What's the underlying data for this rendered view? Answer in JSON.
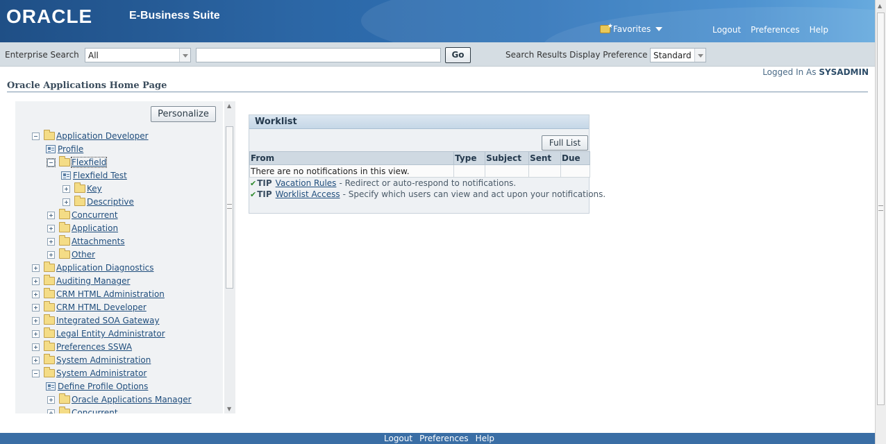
{
  "header": {
    "logo_text": "ORACLE",
    "suite_name": "E-Business Suite",
    "favorites_label": "Favorites",
    "links": [
      "Logout",
      "Preferences",
      "Help"
    ]
  },
  "search": {
    "label": "Enterprise Search",
    "scope_value": "All",
    "query_value": "",
    "go_label": "Go",
    "display_pref_label": "Search Results Display Preference",
    "display_pref_value": "Standard"
  },
  "session": {
    "logged_in_label": "Logged In As",
    "user": "SYSADMIN"
  },
  "page_title": "Oracle Applications Home Page",
  "navigator": {
    "personalize_label": "Personalize",
    "items": [
      {
        "label": "Application Developer",
        "type": "folder",
        "state": "expanded",
        "level": 0
      },
      {
        "label": "Profile",
        "type": "function",
        "level": 0
      },
      {
        "label": "Flexfield",
        "type": "folder",
        "state": "expanded",
        "level": 1,
        "selected": true
      },
      {
        "label": "Flexfield Test",
        "type": "function",
        "level": 1
      },
      {
        "label": "Key",
        "type": "folder",
        "state": "collapsed",
        "level": 2
      },
      {
        "label": "Descriptive",
        "type": "folder",
        "state": "collapsed",
        "level": 2
      },
      {
        "label": "Concurrent",
        "type": "folder",
        "state": "collapsed",
        "level": 1
      },
      {
        "label": "Application",
        "type": "folder",
        "state": "collapsed",
        "level": 1
      },
      {
        "label": "Attachments",
        "type": "folder",
        "state": "collapsed",
        "level": 1
      },
      {
        "label": "Other",
        "type": "folder",
        "state": "collapsed",
        "level": 1
      },
      {
        "label": "Application Diagnostics",
        "type": "folder",
        "state": "collapsed",
        "level": 0
      },
      {
        "label": "Auditing Manager",
        "type": "folder",
        "state": "collapsed",
        "level": 0
      },
      {
        "label": "CRM HTML Administration",
        "type": "folder",
        "state": "collapsed",
        "level": 0
      },
      {
        "label": "CRM HTML Developer",
        "type": "folder",
        "state": "collapsed",
        "level": 0
      },
      {
        "label": "Integrated SOA Gateway",
        "type": "folder",
        "state": "collapsed",
        "level": 0
      },
      {
        "label": "Legal Entity Administrator",
        "type": "folder",
        "state": "collapsed",
        "level": 0
      },
      {
        "label": "Preferences SSWA",
        "type": "folder",
        "state": "collapsed",
        "level": 0
      },
      {
        "label": "System Administration",
        "type": "folder",
        "state": "collapsed",
        "level": 0
      },
      {
        "label": "System Administrator",
        "type": "folder",
        "state": "expanded",
        "level": 0
      },
      {
        "label": "Define Profile Options",
        "type": "function",
        "level": 0
      },
      {
        "label": "Oracle Applications Manager",
        "type": "folder",
        "state": "collapsed",
        "level": 1
      },
      {
        "label": "Concurrent",
        "type": "folder",
        "state": "collapsed",
        "level": 1
      }
    ]
  },
  "worklist": {
    "title": "Worklist",
    "full_list_label": "Full List",
    "columns": [
      "From",
      "Type",
      "Subject",
      "Sent",
      "Due"
    ],
    "empty_message": "There are no notifications in this view.",
    "tips": [
      {
        "tag": "TIP",
        "link": "Vacation Rules",
        "text": "- Redirect or auto-respond to notifications."
      },
      {
        "tag": "TIP",
        "link": "Worklist Access",
        "text": "- Specify which users can view and act upon your notifications."
      }
    ]
  },
  "footer": {
    "links": [
      "Logout",
      "Preferences",
      "Help"
    ]
  },
  "colors": {
    "banner": "#2c67a6",
    "link": "#1f4d7c",
    "footer": "#3a6ea5"
  }
}
